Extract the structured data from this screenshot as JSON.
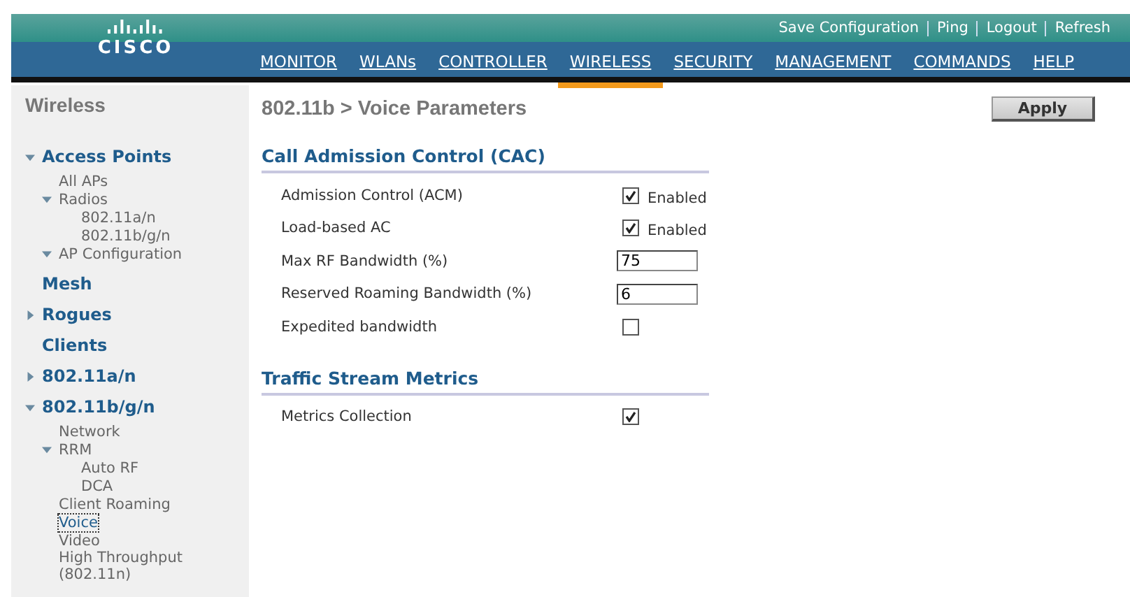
{
  "header": {
    "logo": "CISCO",
    "links": [
      "Save Configuration",
      "Ping",
      "Logout",
      "Refresh"
    ],
    "nav": [
      {
        "label": "MONITOR",
        "selected": false
      },
      {
        "label": "WLANs",
        "selected": false
      },
      {
        "label": "CONTROLLER",
        "selected": false
      },
      {
        "label": "WIRELESS",
        "selected": true
      },
      {
        "label": "SECURITY",
        "selected": false
      },
      {
        "label": "MANAGEMENT",
        "selected": false
      },
      {
        "label": "COMMANDS",
        "selected": false
      },
      {
        "label": "HELP",
        "selected": false
      }
    ]
  },
  "sidebar": {
    "title": "Wireless",
    "items": [
      {
        "label": "Access Points",
        "expanded": true,
        "selected": false,
        "children": [
          {
            "label": "All APs",
            "selected": false
          },
          {
            "label": "Radios",
            "expanded": true,
            "selected": false,
            "children": [
              {
                "label": "802.11a/n",
                "selected": false
              },
              {
                "label": "802.11b/g/n",
                "selected": false
              }
            ]
          },
          {
            "label": "AP Configuration",
            "expanded": true,
            "selected": false
          }
        ]
      },
      {
        "label": "Mesh",
        "selected": false
      },
      {
        "label": "Rogues",
        "expanded": false,
        "selected": false
      },
      {
        "label": "Clients",
        "selected": false
      },
      {
        "label": "802.11a/n",
        "expanded": false,
        "selected": false
      },
      {
        "label": "802.11b/g/n",
        "expanded": true,
        "selected": false,
        "children": [
          {
            "label": "Network",
            "selected": false
          },
          {
            "label": "RRM",
            "expanded": true,
            "selected": false,
            "children": [
              {
                "label": "Auto RF",
                "selected": false
              },
              {
                "label": "DCA",
                "selected": false
              }
            ]
          },
          {
            "label": "Client Roaming",
            "selected": false
          },
          {
            "label": "Voice",
            "selected": true
          },
          {
            "label": "Video",
            "selected": false
          },
          {
            "label": "High Throughput (802.11n)",
            "selected": false
          }
        ]
      }
    ]
  },
  "page": {
    "title": "802.11b > Voice Parameters",
    "apply": "Apply",
    "sections": [
      {
        "title": "Call Admission Control (CAC)",
        "rows": [
          {
            "kind": "checkbox",
            "label": "Admission Control (ACM)",
            "checked": true,
            "caption": "Enabled"
          },
          {
            "kind": "checkbox",
            "label": "Load-based AC",
            "checked": true,
            "caption": "Enabled"
          },
          {
            "kind": "input",
            "label": "Max RF Bandwidth (%)",
            "value": "75"
          },
          {
            "kind": "input",
            "label": "Reserved Roaming Bandwidth (%)",
            "value": "6"
          },
          {
            "kind": "checkbox",
            "label": "Expedited bandwidth",
            "checked": false
          }
        ]
      },
      {
        "title": "Traffic Stream Metrics",
        "rows": [
          {
            "kind": "checkbox",
            "label": "Metrics Collection",
            "checked": true
          }
        ]
      }
    ]
  }
}
